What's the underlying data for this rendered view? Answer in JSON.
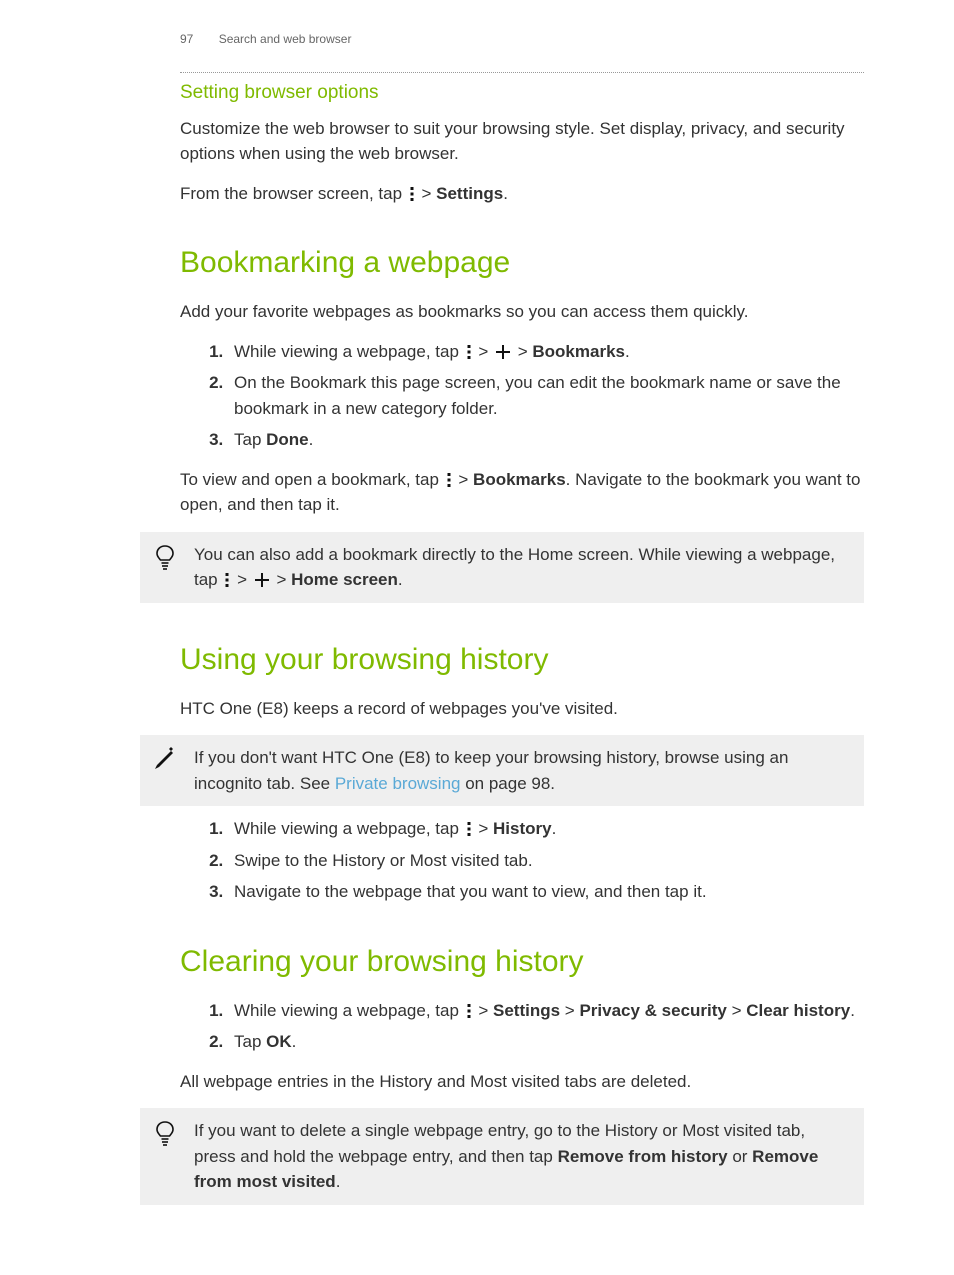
{
  "header": {
    "page_number": "97",
    "chapter": "Search and web browser"
  },
  "subsection1": {
    "title": "Setting browser options",
    "intro": "Customize the web browser to suit your browsing style. Set display, privacy, and security options when using the web browser.",
    "instruction_prefix": "From the browser screen, tap ",
    "instruction_sep": " > ",
    "settings_label": "Settings",
    "instruction_suffix": "."
  },
  "section_bookmark": {
    "title": "Bookmarking a webpage",
    "intro": "Add your favorite webpages as bookmarks so you can access them quickly.",
    "step1_prefix": "While viewing a webpage, tap ",
    "step1_sep1": " > ",
    "step1_sep2": " > ",
    "step1_bookmarks": "Bookmarks",
    "step1_suffix": ".",
    "step2": "On the Bookmark this page screen, you can edit the bookmark name or save the bookmark in a new category folder.",
    "step3_prefix": "Tap ",
    "step3_done": "Done",
    "step3_suffix": ".",
    "after_prefix": "To view and open a bookmark, tap ",
    "after_sep": " > ",
    "after_bookmarks": "Bookmarks",
    "after_suffix": ". Navigate to the bookmark you want to open, and then tap it.",
    "tip_prefix": "You can also add a bookmark directly to the Home screen. While viewing a webpage, tap ",
    "tip_sep1": " > ",
    "tip_sep2": " > ",
    "tip_home": "Home screen",
    "tip_suffix": "."
  },
  "section_history": {
    "title": "Using your browsing history",
    "intro": "HTC One (E8) keeps a record of webpages you've visited.",
    "note_prefix": "If you don't want HTC One (E8) to keep your browsing history, browse using an incognito tab. See ",
    "note_link": "Private browsing",
    "note_suffix": " on page 98.",
    "step1_prefix": "While viewing a webpage, tap ",
    "step1_sep": " > ",
    "step1_history": "History",
    "step1_suffix": ".",
    "step2": "Swipe to the History or Most visited tab.",
    "step3": "Navigate to the webpage that you want to view, and then tap it."
  },
  "section_clear": {
    "title": "Clearing your browsing history",
    "step1_prefix": "While viewing a webpage, tap ",
    "step1_sep": " > ",
    "step1_settings": "Settings",
    "step1_privacy": "Privacy & security",
    "step1_clear": "Clear history",
    "step1_suffix": ".",
    "step2_prefix": "Tap ",
    "step2_ok": "OK",
    "step2_suffix": ".",
    "after": "All webpage entries in the History and Most visited tabs are deleted.",
    "tip_prefix": "If you want to delete a single webpage entry, go to the History or Most visited tab, press and hold the webpage entry, and then tap ",
    "tip_remove_history": "Remove from history",
    "tip_or": " or ",
    "tip_remove_visited": "Remove from most visited",
    "tip_suffix": "."
  }
}
